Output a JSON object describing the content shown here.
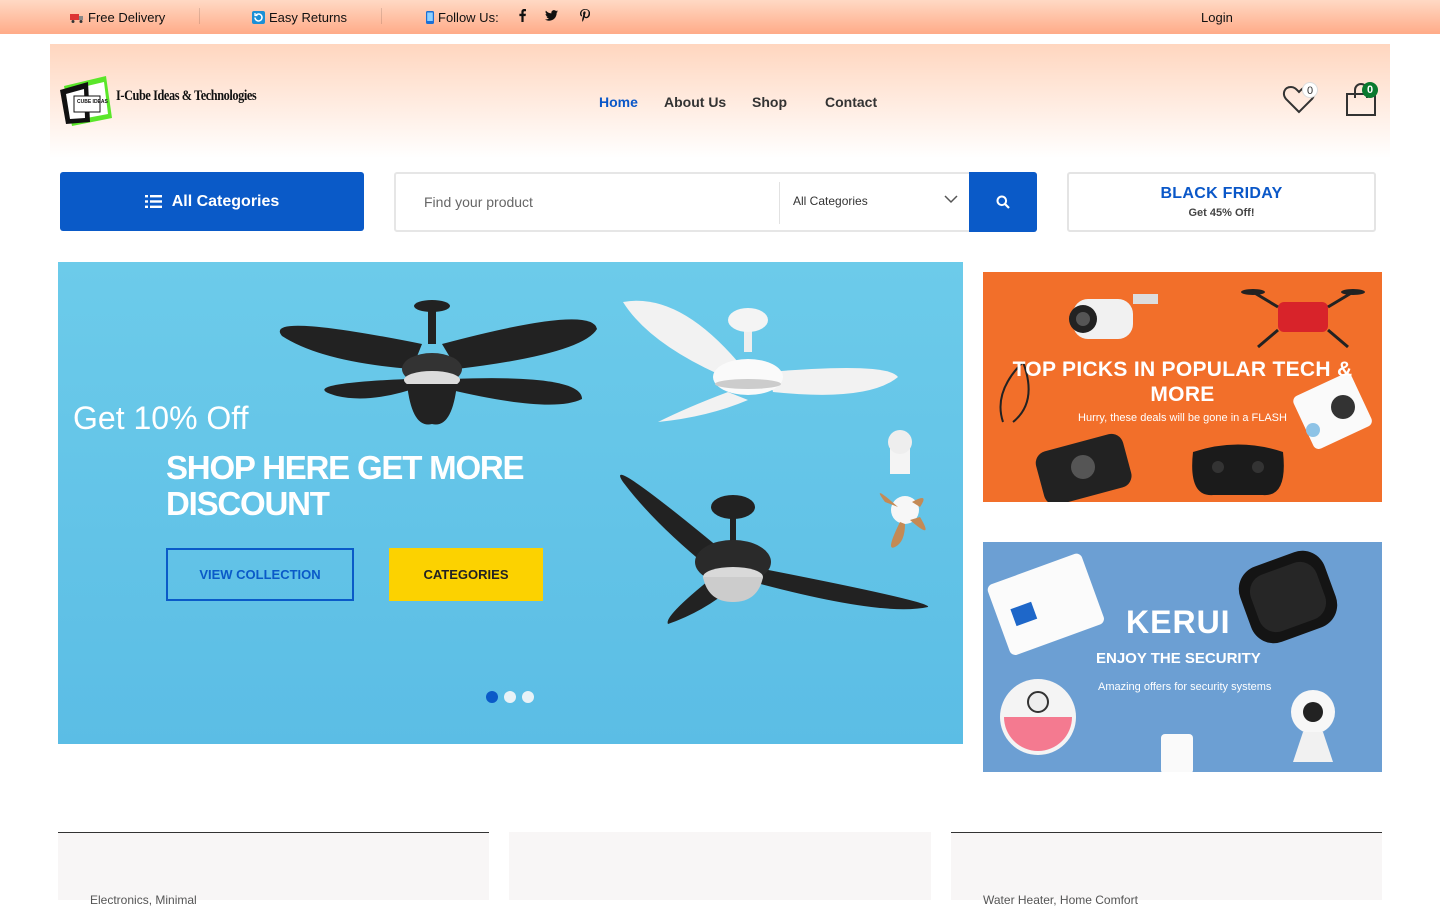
{
  "topbar": {
    "free_delivery": "Free Delivery",
    "easy_returns": "Easy Returns",
    "follow_us": "Follow Us:",
    "social": [
      "facebook-icon",
      "twitter-icon",
      "pinterest-icon"
    ],
    "login": "Login"
  },
  "header": {
    "logo_text": "I-Cube Ideas & Technologies",
    "logo_badge": "CUBE IDEAS",
    "nav": [
      {
        "label": "Home",
        "active": true
      },
      {
        "label": "About Us"
      },
      {
        "label": "Shop"
      },
      {
        "label": "Contact"
      }
    ],
    "wishlist_count": "0",
    "cart_count": "0"
  },
  "search": {
    "all_categories_label": "All Categories",
    "placeholder": "Find your product",
    "category_select": "All Categories"
  },
  "promo": {
    "title": "BLACK FRIDAY",
    "subtitle": "Get 45% Off!"
  },
  "hero": {
    "kicker": "Get 10% Off",
    "headline": "SHOP HERE GET MORE DISCOUNT",
    "primary_button": "VIEW COLLECTION",
    "secondary_button": "CATEGORIES",
    "slides": 3,
    "active_slide": 1
  },
  "banner_tech": {
    "title": "TOP PICKS IN POPULAR TECH & MORE",
    "subtitle": "Hurry, these deals will be gone in a FLASH"
  },
  "banner_security": {
    "brand": "KERUI",
    "title": "ENJOY THE SECURITY",
    "subtitle": "Amazing offers for security systems"
  },
  "cards": [
    {
      "label": "Electronics, Minimal"
    },
    {
      "label": ""
    },
    {
      "label": "Water Heater, Home Comfort"
    }
  ],
  "colors": {
    "primary": "#0a5ac8",
    "yellow": "#fcd200",
    "orange": "#f26f2a",
    "sky": "#6ccbea"
  }
}
